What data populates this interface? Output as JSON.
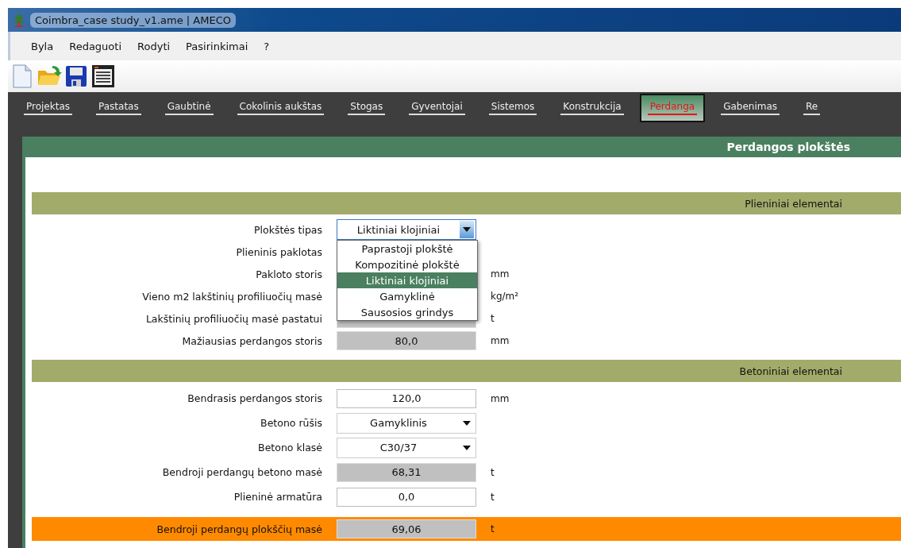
{
  "window": {
    "title": "Coimbra_case study_v1.ame | AMECO"
  },
  "menu": [
    "Byla",
    "Redaguoti",
    "Rodyti",
    "Pasirinkimai",
    "?"
  ],
  "tabs": [
    {
      "label": "Projektas",
      "selected": false
    },
    {
      "label": "Pastatas",
      "selected": false
    },
    {
      "label": "Gaubtinė",
      "selected": false
    },
    {
      "label": "Cokolinis aukštas",
      "selected": false
    },
    {
      "label": "Stogas",
      "selected": false
    },
    {
      "label": "Gyventojai",
      "selected": false
    },
    {
      "label": "Sistemos",
      "selected": false
    },
    {
      "label": "Konstrukcija",
      "selected": false
    },
    {
      "label": "Perdanga",
      "selected": true
    },
    {
      "label": "Gabenimas",
      "selected": false
    },
    {
      "label": "Re",
      "selected": false
    }
  ],
  "panel_title": "Perdangos plokštės",
  "sections": [
    {
      "title": "Plieniniai elementai",
      "rows": [
        {
          "label": "Plokštės tipas",
          "kind": "combo",
          "value": "Liktiniai klojiniai",
          "open": true,
          "options": [
            {
              "label": "Paprastoji plokštė",
              "selected": false
            },
            {
              "label": "Kompozitinė plokštė",
              "selected": false
            },
            {
              "label": "Liktiniai klojiniai",
              "selected": true
            },
            {
              "label": "Gamyklinė",
              "selected": false
            },
            {
              "label": "Sausosios grindys",
              "selected": false
            }
          ]
        },
        {
          "label": "Plieninis paklotas",
          "kind": "hidden"
        },
        {
          "label": "Pakloto storis",
          "kind": "hidden",
          "unit": "mm"
        },
        {
          "label": "Vieno m2 lakštinių profiliuočių masė",
          "kind": "hidden",
          "unit": "kg/m²"
        },
        {
          "label": "Lakštinių profiliuočių masė pastatui",
          "kind": "readonly",
          "unit": "t"
        },
        {
          "label": "Mažiausias perdangos storis",
          "kind": "readonly",
          "value": "80,0",
          "unit": "mm"
        }
      ]
    },
    {
      "title": "Betoniniai elementai",
      "rows": [
        {
          "label": "Bendrasis perdangos storis",
          "kind": "input",
          "value": "120,0",
          "unit": "mm"
        },
        {
          "label": "Betono rūšis",
          "kind": "combo",
          "value": "Gamyklinis",
          "open": false
        },
        {
          "label": "Betono klasė",
          "kind": "combo",
          "value": "C30/37",
          "open": false
        },
        {
          "label": "Bendroji perdangų betono masė",
          "kind": "readonly",
          "value": "68,31",
          "unit": "t"
        },
        {
          "label": "Plieninė armatūra",
          "kind": "input",
          "value": "0,0",
          "unit": "t"
        }
      ]
    }
  ],
  "total": {
    "label": "Bendroji perdangų plokščių masė",
    "value": "69,06",
    "unit": "t"
  }
}
